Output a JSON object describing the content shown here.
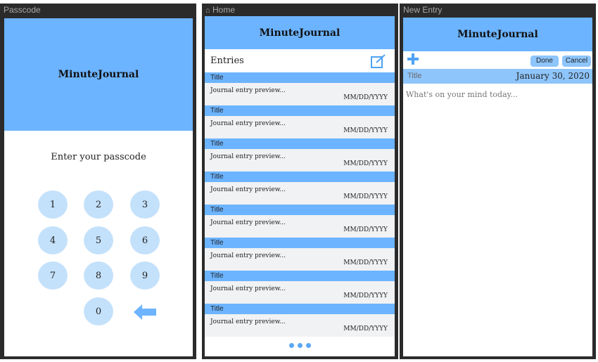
{
  "passcode": {
    "window_title": "Passcode",
    "app_title": "MinuteJournal",
    "prompt": "Enter your passcode",
    "keys": [
      "1",
      "2",
      "3",
      "4",
      "5",
      "6",
      "7",
      "8",
      "9",
      "0"
    ],
    "accent": "#6cb4ff",
    "key_color": "#c4e1fb"
  },
  "home": {
    "window_title": "Home",
    "app_title": "MinuteJournal",
    "section_label": "Entries",
    "entries": [
      {
        "title": "Title",
        "preview": "Journal entry preview...",
        "date": "MM/DD/YYYY"
      },
      {
        "title": "Title",
        "preview": "Journal entry preview...",
        "date": "MM/DD/YYYY"
      },
      {
        "title": "Title",
        "preview": "Journal entry preview...",
        "date": "MM/DD/YYYY"
      },
      {
        "title": "Title",
        "preview": "Journal entry preview...",
        "date": "MM/DD/YYYY"
      },
      {
        "title": "Title",
        "preview": "Journal entry preview...",
        "date": "MM/DD/YYYY"
      },
      {
        "title": "Title",
        "preview": "Journal entry preview...",
        "date": "MM/DD/YYYY"
      },
      {
        "title": "Title",
        "preview": "Journal entry preview...",
        "date": "MM/DD/YYYY"
      },
      {
        "title": "Title",
        "preview": "Journal entry preview...",
        "date": "MM/DD/YYYY"
      }
    ]
  },
  "new_entry": {
    "window_title": "New Entry",
    "app_title": "MinuteJournal",
    "done_label": "Done",
    "cancel_label": "Cancel",
    "title_placeholder": "Title",
    "date": "January 30, 2020",
    "body_placeholder": "What's on your mind today..."
  }
}
